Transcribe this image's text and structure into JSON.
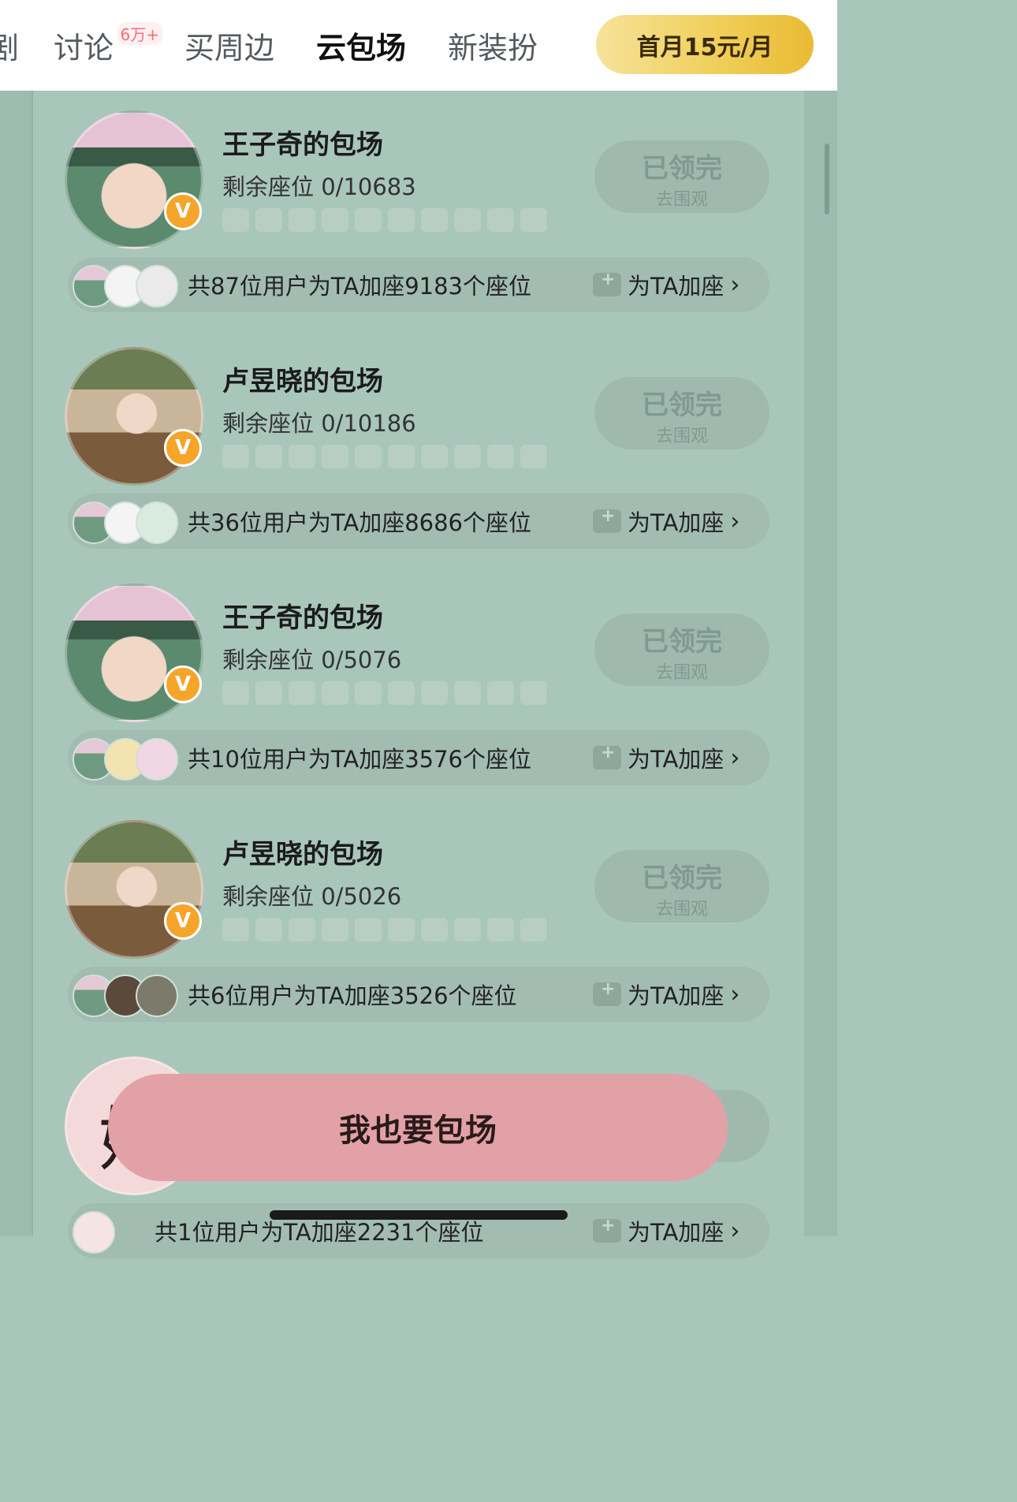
{
  "nav": {
    "cut_label": "剧",
    "tabs": [
      {
        "label": "讨论",
        "badge": "6万+"
      },
      {
        "label": "买周边"
      },
      {
        "label": "云包场"
      },
      {
        "label": "新装扮"
      }
    ],
    "vip_button": "首月15元/月"
  },
  "cards": [
    {
      "title": "王子奇的包场",
      "seats": "剩余座位 0/10683",
      "status": "已领完",
      "status_sub": "去围观",
      "summary": "共87位用户为TA加座9183个座位",
      "add_seat": "为TA加座",
      "avatar": "male"
    },
    {
      "title": "卢昱晓的包场",
      "seats": "剩余座位 0/10186",
      "status": "已领完",
      "status_sub": "去围观",
      "summary": "共36位用户为TA加座8686个座位",
      "add_seat": "为TA加座",
      "avatar": "female"
    },
    {
      "title": "王子奇的包场",
      "seats": "剩余座位 0/5076",
      "status": "已领完",
      "status_sub": "去围观",
      "summary": "共10位用户为TA加座3576个座位",
      "add_seat": "为TA加座",
      "avatar": "male"
    },
    {
      "title": "卢昱晓的包场",
      "seats": "剩余座位 0/5026",
      "status": "已领完",
      "status_sub": "去围观",
      "summary": "共6位用户为TA加座3526个座位",
      "add_seat": "为TA加座",
      "avatar": "female"
    },
    {
      "summary": "共1位用户为TA加座2231个座位",
      "add_seat": "为TA加座",
      "avatar": "brush",
      "avatar_text": "婷"
    }
  ],
  "cta": "我也要包场",
  "colors": {
    "page_bg": "#a9c6bb",
    "vip_gold": "#f0cf5a",
    "cta_pink": "#e2a1a6",
    "verified_orange": "#f5a52a"
  }
}
